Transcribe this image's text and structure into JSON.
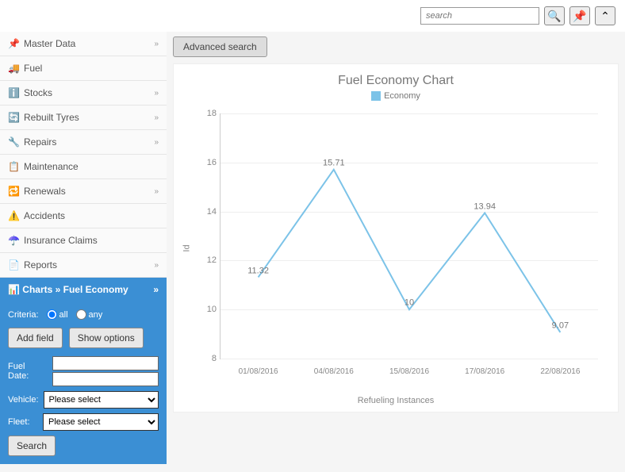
{
  "topbar": {
    "search_placeholder": "search"
  },
  "sidebar": {
    "items": [
      {
        "label": "Master Data",
        "icon": "📌",
        "hasChev": true
      },
      {
        "label": "Fuel",
        "icon": "🚚",
        "hasChev": false
      },
      {
        "label": "Stocks",
        "icon": "ℹ️",
        "hasChev": true
      },
      {
        "label": "Rebuilt Tyres",
        "icon": "🔄",
        "hasChev": true
      },
      {
        "label": "Repairs",
        "icon": "🔧",
        "hasChev": true
      },
      {
        "label": "Maintenance",
        "icon": "📋",
        "hasChev": false
      },
      {
        "label": "Renewals",
        "icon": "🔁",
        "hasChev": true
      },
      {
        "label": "Accidents",
        "icon": "⚠️",
        "hasChev": false
      },
      {
        "label": "Insurance Claims",
        "icon": "☂️",
        "hasChev": false
      },
      {
        "label": "Reports",
        "icon": "📄",
        "hasChev": true
      }
    ],
    "active": {
      "breadcrumb": "Charts » Fuel Economy"
    }
  },
  "filters": {
    "criteria_label": "Criteria:",
    "all": "all",
    "any": "any",
    "add_field": "Add field",
    "show_options": "Show options",
    "fuel_date_label": "Fuel Date:",
    "vehicle_label": "Vehicle:",
    "fleet_label": "Fleet:",
    "please_select": "Please select",
    "search": "Search"
  },
  "main": {
    "advanced_search": "Advanced search"
  },
  "chart_data": {
    "type": "line",
    "title": "Fuel Economy Chart",
    "legend": "Economy",
    "ylabel": "Id",
    "xlabel": "Refueling Instances",
    "ylim": [
      8,
      18
    ],
    "yticks": [
      8,
      10,
      12,
      14,
      16,
      18
    ],
    "categories": [
      "01/08/2016",
      "04/08/2016",
      "15/08/2016",
      "17/08/2016",
      "22/08/2016"
    ],
    "series": [
      {
        "name": "Economy",
        "values": [
          11.32,
          15.71,
          10,
          13.94,
          9.07
        ],
        "color": "#7cc3e8"
      }
    ]
  }
}
